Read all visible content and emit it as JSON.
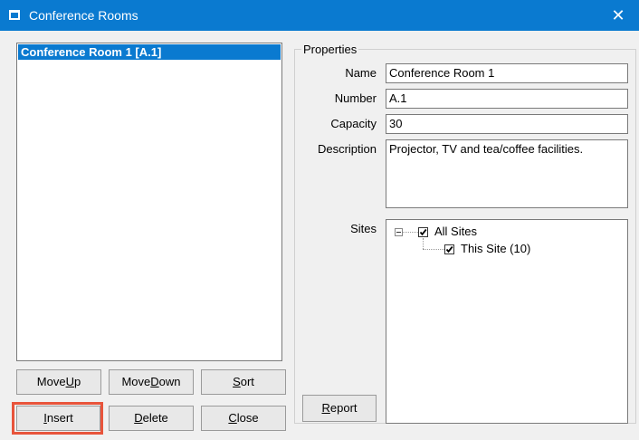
{
  "window": {
    "title": "Conference Rooms",
    "close_glyph": "✕",
    "icon": "app-window-icon",
    "accent": "#0a7ad0",
    "highlight": "#e8543b"
  },
  "list": {
    "items": [
      {
        "label": "Conference Room 1 [A.1]",
        "selected": true
      }
    ]
  },
  "buttons": {
    "move_up": {
      "pre": "Move ",
      "acc": "U",
      "post": "p"
    },
    "move_down": {
      "pre": "Move ",
      "acc": "D",
      "post": "own"
    },
    "sort": {
      "pre": "",
      "acc": "S",
      "post": "ort"
    },
    "insert": {
      "pre": "",
      "acc": "I",
      "post": "nsert"
    },
    "delete": {
      "pre": "",
      "acc": "D",
      "post": "elete"
    },
    "close": {
      "pre": "",
      "acc": "C",
      "post": "lose"
    },
    "report": {
      "pre": "",
      "acc": "R",
      "post": "eport"
    }
  },
  "properties": {
    "group_label": "Properties",
    "name_label": "Name",
    "name_value": "Conference Room 1",
    "number_label": "Number",
    "number_value": "A.1",
    "capacity_label": "Capacity",
    "capacity_value": "30",
    "description_label": "Description",
    "description_value": "Projector, TV and tea/coffee facilities.",
    "sites_label": "Sites"
  },
  "sites_tree": {
    "root": {
      "label": "All Sites",
      "checked": true,
      "expanded": true
    },
    "children": [
      {
        "label": "This Site (10)",
        "checked": true
      }
    ]
  }
}
